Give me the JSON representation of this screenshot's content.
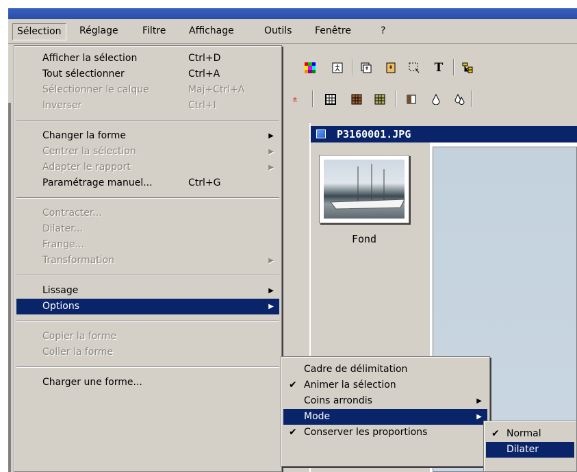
{
  "menubar": {
    "items": [
      "Sélection",
      "Réglage",
      "Filtre",
      "Affichage",
      "Outils",
      "Fenêtre",
      "?"
    ]
  },
  "document": {
    "title": "P3160001.JPG",
    "layer_name": "Fond"
  },
  "selection_menu": {
    "items": [
      {
        "label": "Afficher la sélection",
        "shortcut": "Ctrl+D"
      },
      {
        "label": "Tout sélectionner",
        "shortcut": "Ctrl+A"
      },
      {
        "label": "Sélectionner le calque",
        "shortcut": "Maj+Ctrl+A"
      },
      {
        "label": "Inverser",
        "shortcut": "Ctrl+I"
      },
      {
        "label": "Changer la forme"
      },
      {
        "label": "Centrer la sélection"
      },
      {
        "label": "Adapter le rapport"
      },
      {
        "label": "Paramétrage manuel...",
        "shortcut": "Ctrl+G"
      },
      {
        "label": "Contracter..."
      },
      {
        "label": "Dilater..."
      },
      {
        "label": "Frange..."
      },
      {
        "label": "Transformation"
      },
      {
        "label": "Lissage"
      },
      {
        "label": "Options"
      },
      {
        "label": "Copier la forme"
      },
      {
        "label": "Coller la forme"
      },
      {
        "label": "Charger une forme..."
      }
    ]
  },
  "options_submenu": {
    "items": [
      {
        "label": "Cadre de délimitation"
      },
      {
        "label": "Animer la sélection"
      },
      {
        "label": "Coins arrondis"
      },
      {
        "label": "Mode"
      },
      {
        "label": "Conserver les proportions"
      }
    ]
  },
  "mode_submenu": {
    "items": [
      {
        "label": "Normal"
      },
      {
        "label": "Dilater"
      }
    ]
  },
  "glyphs": {
    "check": "✔",
    "arrow": "▶",
    "text_tool": "T"
  },
  "colors": {
    "menu_bg": "#d4d0c8",
    "highlight": "#0a246a",
    "disabled_text": "#8a877f"
  }
}
